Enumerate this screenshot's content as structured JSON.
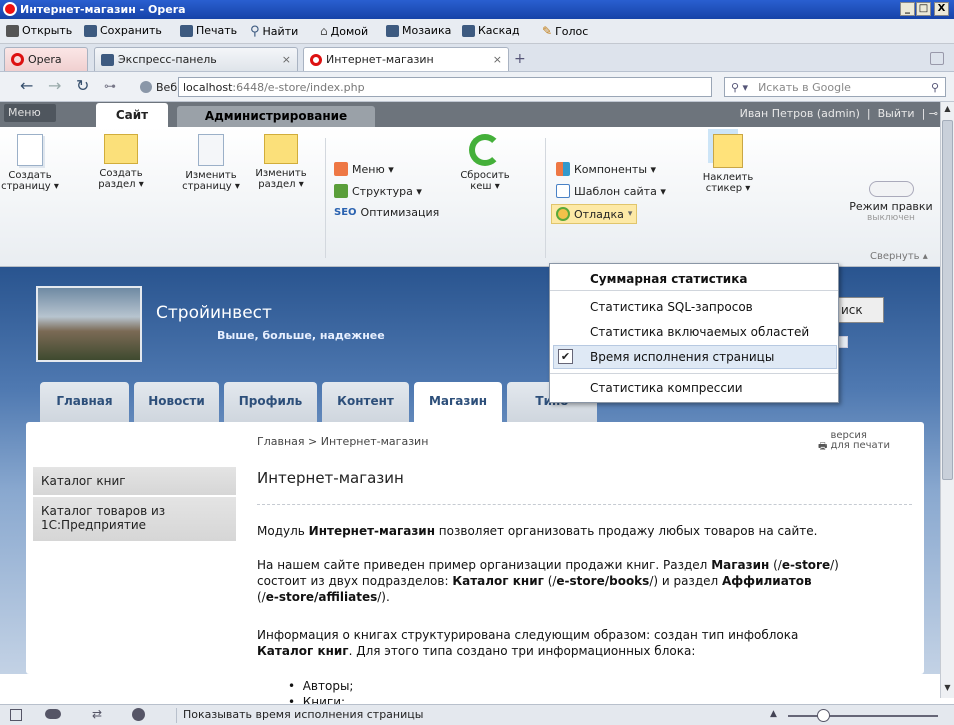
{
  "window": {
    "title": "Интернет-магазин - Opera",
    "controls": [
      "_",
      "□",
      "X"
    ]
  },
  "menubar": [
    {
      "label": "Открыть",
      "icon": "folder-icon",
      "color": "#555555"
    },
    {
      "label": "Сохранить",
      "icon": "save-icon",
      "color": "#3d5a80"
    },
    {
      "label": "Печать",
      "icon": "print-icon",
      "color": "#3d5a80"
    },
    {
      "label": "Найти",
      "icon": "search-icon",
      "color": "#3d5a80"
    },
    {
      "label": "Домой",
      "icon": "home-icon",
      "color": "#555555"
    },
    {
      "label": "Мозаика",
      "icon": "tile-icon",
      "color": "#3d5a80"
    },
    {
      "label": "Каскад",
      "icon": "cascade-icon",
      "color": "#3d5a80"
    },
    {
      "label": "Голос",
      "icon": "microphone-icon",
      "color": "#c07a10"
    }
  ],
  "tabs": {
    "opera_menu": "Opera",
    "items": [
      {
        "label": "Экспресс-панель",
        "close": "×"
      },
      {
        "label": "Интернет-магазин",
        "close": "×"
      }
    ],
    "add": "+"
  },
  "address": {
    "label": "Веб",
    "host": "localhost",
    "rest": ":6448/e-store/index.php",
    "search_placeholder": "Искать в Google"
  },
  "admin": {
    "menu": "Меню",
    "tab_site": "Сайт",
    "tab_admin": "Администрирование",
    "user": "Иван Петров (admin)",
    "logout": "Выйти",
    "buttons": {
      "create_page": [
        "Создать",
        "страницу ▾"
      ],
      "create_section": [
        "Создать",
        "раздел ▾"
      ],
      "edit_page": [
        "Изменить",
        "страницу ▾"
      ],
      "edit_section": [
        "Изменить",
        "раздел ▾"
      ],
      "reset_cache": [
        "Сбросить",
        "кеш ▾"
      ],
      "sticker": [
        "Наклеить",
        "стикер ▾"
      ]
    },
    "links": {
      "menu": "Меню ▾",
      "structure": "Структура ▾",
      "seo": "Оптимизация",
      "components": "Компоненты ▾",
      "template": "Шаблон сайта ▾",
      "debug": "Отладка"
    },
    "edit_mode": {
      "label": "Режим правки",
      "state": "выключен"
    },
    "collapse": "Свернуть ▴"
  },
  "dropdown": {
    "title": "Суммарная статистика",
    "items": [
      "Статистика SQL-запросов",
      "Статистика включаемых областей",
      "Время исполнения страницы",
      "Статистика компрессии"
    ],
    "checked": "✔"
  },
  "site": {
    "name": "Стройинвест",
    "slogan": "Выше, больше, надежнее",
    "search_btn": "иск",
    "nav": [
      "Главная",
      "Новости",
      "Профиль",
      "Контент",
      "Магазин",
      "Типо"
    ],
    "breadcrumb": "Главная > Интернет-магазин",
    "print": [
      "версия",
      "для печати"
    ],
    "page_title": "Интернет-магазин",
    "sidebar": [
      "Каталог книг",
      "Каталог товаров из 1С:Предприятие"
    ]
  },
  "text": {
    "p1_a": "Модуль ",
    "p1_b": "Интернет-магазин",
    "p1_c": " позволяет организовать продажу любых товаров на сайте.",
    "p2": "На нашем сайте приведен пример организации продажи книг. Раздел",
    "p2_shop": "Магазин",
    "p2_b": " (/",
    "p2_estore": "e-store",
    "p2_c": "/)",
    "p2_line2_a": "состоит из двух подразделов: ",
    "p2_books": "Каталог книг",
    "p2_line2_b": " (/",
    "p2_books_path": "e-store/books",
    "p2_line2_c": "/) и раздел ",
    "p2_aff": "Аффилиатов",
    "p2_line3_a": "(/",
    "p2_aff_path": "e-store/affiliates",
    "p2_line3_b": "/).",
    "p3": "Информация о книгах структурирована следующим образом: создан тип инфоблока",
    "p3_b": "Каталог книг",
    "p3_c": ". Для этого типа создано три информационных блока:",
    "li1": "Авторы;",
    "li2": "Книги;"
  },
  "status": {
    "text": "Показывать время исполнения страницы"
  }
}
